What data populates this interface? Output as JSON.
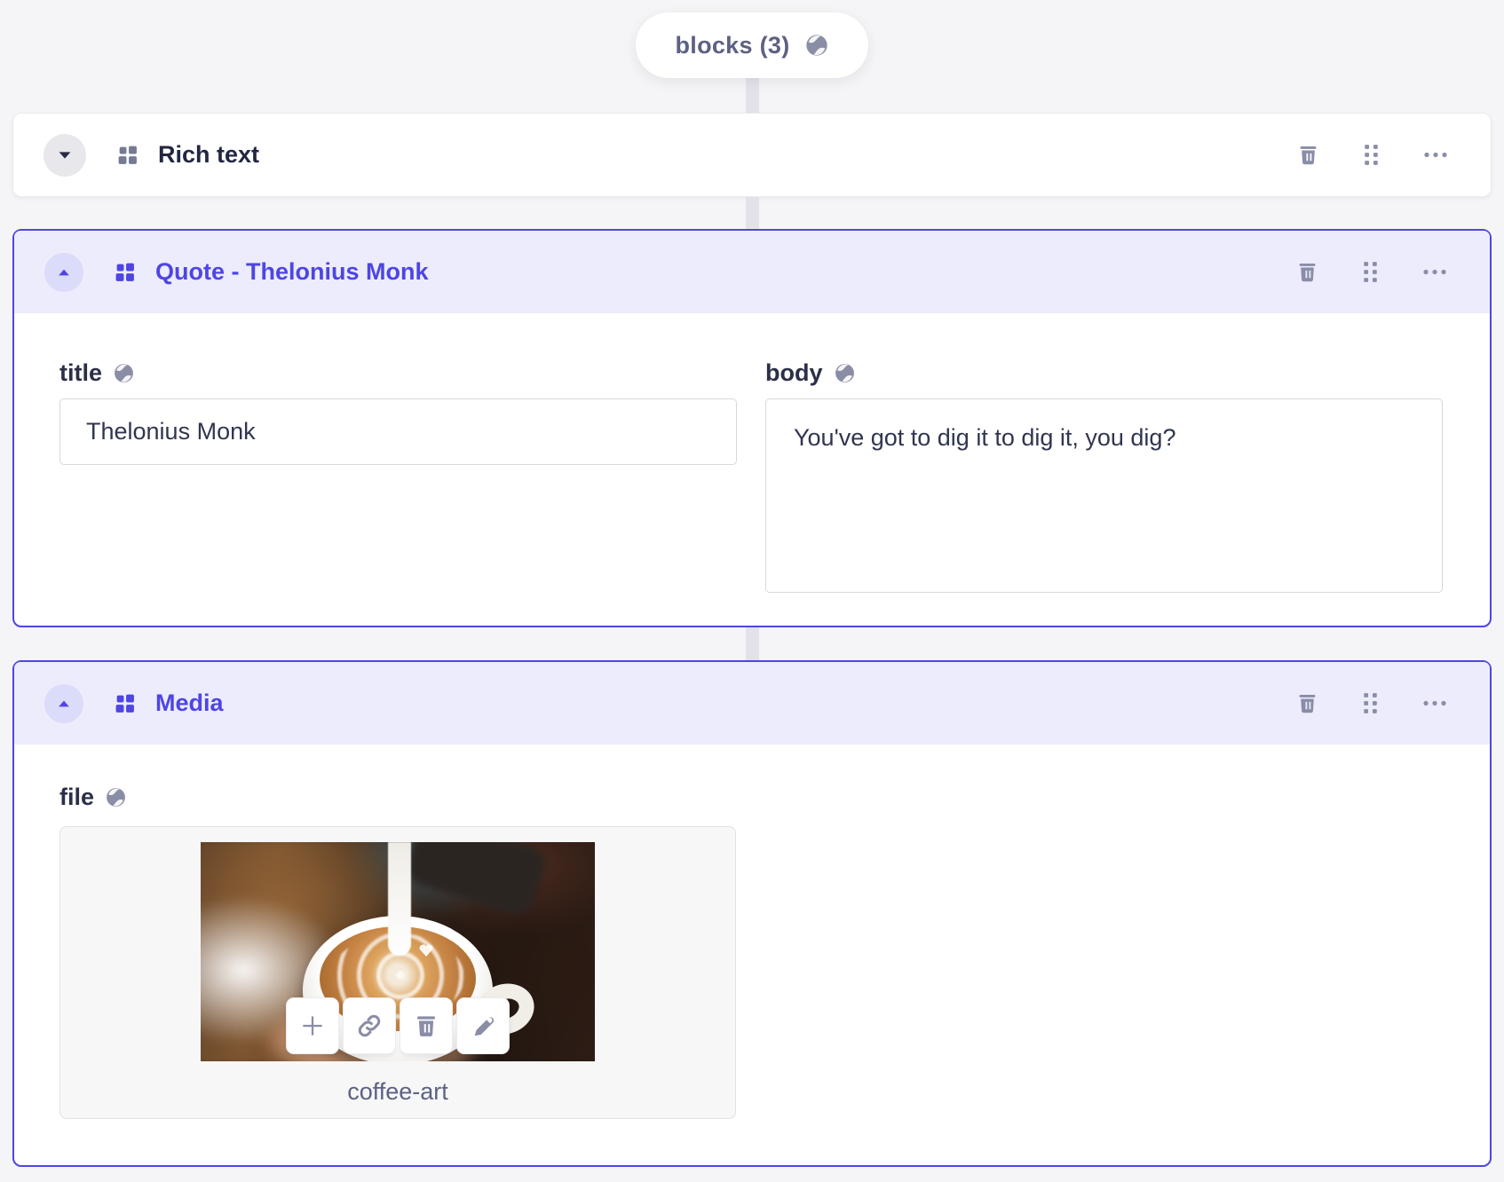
{
  "pill": {
    "label": "blocks (3)"
  },
  "blocks": [
    {
      "label": "Rich text"
    },
    {
      "label": "Quote - Thelonius Monk",
      "fields": {
        "title": {
          "label": "title",
          "value": "Thelonius Monk"
        },
        "body": {
          "label": "body",
          "value": "You've got to dig it to dig it, you dig?"
        }
      }
    },
    {
      "label": "Media",
      "fields": {
        "file": {
          "label": "file",
          "filename": "coffee-art"
        }
      }
    }
  ],
  "icons": {
    "pill_globe": "localized-field-globe",
    "actions": [
      "delete",
      "drag",
      "more-options"
    ],
    "upload_actions": [
      "add",
      "link",
      "delete",
      "edit"
    ]
  },
  "colors": {
    "accent": "#4e45e4",
    "accent_header_bg": "#ececfd",
    "icon_gray": "#8a8da6",
    "page_bg": "#f5f5f7"
  }
}
